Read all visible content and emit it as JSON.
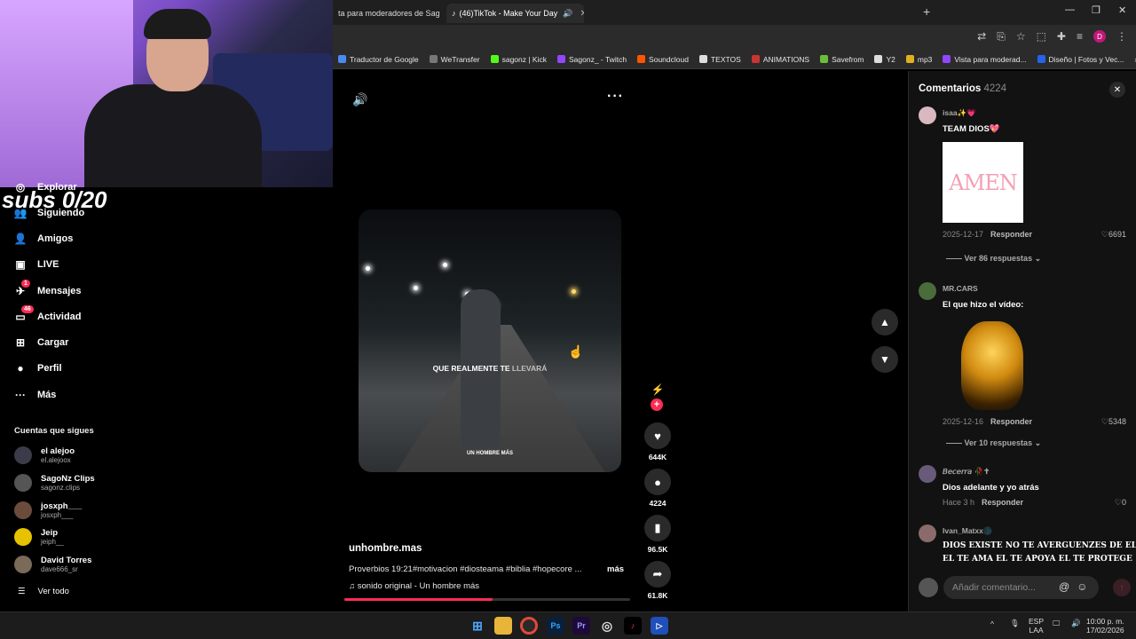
{
  "browser": {
    "tabs": [
      {
        "title": "ta para moderadores de Sag",
        "active": false
      },
      {
        "title": "(46)TikTok - Make Your Day",
        "active": true
      }
    ],
    "bookmarks": [
      {
        "label": "Traductor de Google",
        "color": "#4a8af4"
      },
      {
        "label": "WeTransfer",
        "color": "#777777"
      },
      {
        "label": "sagonz | Kick",
        "color": "#53fc18"
      },
      {
        "label": "Sagonz_ - Twitch",
        "color": "#9146ff"
      },
      {
        "label": "Soundcloud",
        "color": "#ff5500"
      },
      {
        "label": "TEXTOS",
        "color": "#dddddd"
      },
      {
        "label": "ANIMATIONS",
        "color": "#cc3333"
      },
      {
        "label": "Savefrom",
        "color": "#6abf3a"
      },
      {
        "label": "Y2",
        "color": "#dddddd"
      },
      {
        "label": "mp3",
        "color": "#e0b020"
      },
      {
        "label": "Vista para moderad...",
        "color": "#9146ff"
      },
      {
        "label": "Diseño | Fotos y Vec...",
        "color": "#2563eb"
      }
    ],
    "avatar_letter": "D"
  },
  "overlay": {
    "subs_text": "subs 0/20"
  },
  "nav": {
    "items": [
      {
        "label": "Explorar",
        "icon": "compass-icon"
      },
      {
        "label": "Siguiendo",
        "icon": "following-icon"
      },
      {
        "label": "Amigos",
        "icon": "friends-icon"
      },
      {
        "label": "LIVE",
        "icon": "live-icon"
      },
      {
        "label": "Mensajes",
        "icon": "messages-icon",
        "badge": "1"
      },
      {
        "label": "Actividad",
        "icon": "activity-icon",
        "badge": "46"
      },
      {
        "label": "Cargar",
        "icon": "upload-icon"
      },
      {
        "label": "Perfil",
        "icon": "profile-icon"
      },
      {
        "label": "Más",
        "icon": "more-icon"
      }
    ],
    "following_title": "Cuentas que sigues",
    "following": [
      {
        "name": "el alejoo",
        "handle": "el.alejoox",
        "color": "#3b3b4a"
      },
      {
        "name": "SagoNz Clips",
        "handle": "sagonz.clips",
        "color": "#555555"
      },
      {
        "name": "josxph___",
        "handle": "josxph___",
        "color": "#6b4b3b"
      },
      {
        "name": "Jeip",
        "handle": "jeiph__",
        "color": "#e6c200"
      },
      {
        "name": "David Torres",
        "handle": "dave666_sr",
        "color": "#7a6a5a"
      }
    ],
    "see_all": "Ver todo"
  },
  "video": {
    "caption_main": "QUE REALMENTE TE",
    "caption_dim": "LLEVARÁ",
    "watermark": "UN HOMBRE MÁS",
    "author": "unhombre.mas",
    "description": "Proverbios 19:21#motivacion #diosteama #biblia #hopecore ...",
    "more_label": "más",
    "sound": "sonido original - Un hombre más",
    "progress": 0.52
  },
  "actions": {
    "likes": "644K",
    "comments": "4224",
    "saves": "96.5K",
    "shares": "61.8K"
  },
  "comments": {
    "title": "Comentarios",
    "count": "4224",
    "items": [
      {
        "user": "isaa✨💗",
        "text": "TEAM DIOS💖",
        "date": "2025-12-17",
        "reply": "Responder",
        "likes": "6691",
        "more": "Ver 86 respuestas",
        "avatar_color": "#d9b8c0",
        "image_text": "AMEN"
      },
      {
        "user": "MR.CARS",
        "text": "El que hizo el vídeo:",
        "date": "2025-12-16",
        "reply": "Responder",
        "likes": "5348",
        "more": "Ver 10 respuestas",
        "avatar_color": "#4a6b3a"
      },
      {
        "user": "𝘉𝘦𝘤𝘦𝘳𝘳𝘢 🥀✝",
        "text": "Dios adelante y yo atrás",
        "date": "Hace 3 h",
        "reply": "Responder",
        "likes": "0",
        "avatar_color": "#6a5a7a"
      },
      {
        "user": "Ivan_Matxx🌑",
        "text": "DIOS EXISTE NO TE AVERGUENZES DE EL",
        "text2": "EL TE AMA EL TE APOYA EL TE PROTEGE",
        "avatar_color": "#8a6a6a"
      }
    ],
    "input_placeholder": "Añadir comentario..."
  },
  "taskbar": {
    "lang_top": "ESP",
    "lang_bottom": "LAA",
    "time": "10:00 p. m.",
    "date": "17/02/2026"
  }
}
